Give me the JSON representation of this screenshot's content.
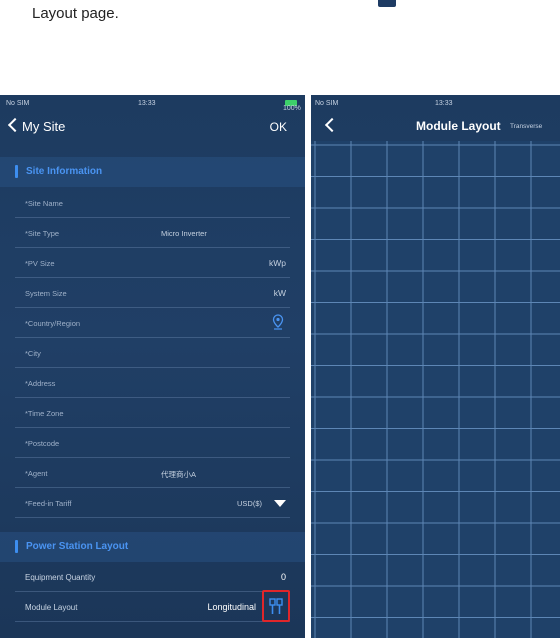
{
  "caption": "Layout page.",
  "left": {
    "status": {
      "carrier": "No SIM",
      "time": "13:33",
      "battery": "100%"
    },
    "nav": {
      "back_label": "My Site",
      "ok_label": "OK"
    },
    "sections": {
      "site_info": "Site Information",
      "power_station": "Power Station Layout"
    },
    "rows": [
      {
        "label": "*Site Name",
        "value": ""
      },
      {
        "label": "*Site Type",
        "value": "Micro Inverter"
      },
      {
        "label": "*PV Size",
        "unit": "kWp"
      },
      {
        "label": "System Size",
        "unit": "kW"
      },
      {
        "label": "*Country/Region",
        "icon": "location-pin-icon"
      },
      {
        "label": "*City"
      },
      {
        "label": "*Address"
      },
      {
        "label": "*Time Zone"
      },
      {
        "label": "*Postcode"
      },
      {
        "label": "*Agent",
        "value": "代理商小A"
      },
      {
        "label": "*Feed-in Tariff",
        "value": "USD($)",
        "icon": "dropdown-arrow-icon"
      }
    ],
    "equipment": {
      "label": "Equipment Quantity",
      "value": "0"
    },
    "module_layout": {
      "label": "Module Layout",
      "value": "Longitudinal",
      "icon": "module-layout-icon"
    }
  },
  "right": {
    "status": {
      "carrier": "No SIM",
      "time": "13:33"
    },
    "nav": {
      "title": "Module Layout",
      "extra": "Transverse"
    },
    "grid": {
      "columns": 7,
      "rows": 16,
      "line_color": "#5d86b5",
      "background": "#1f4169"
    }
  },
  "colors": {
    "accent": "#3d8ef0",
    "highlight": "#e0262a",
    "panel_bg": "#1d3b60"
  }
}
